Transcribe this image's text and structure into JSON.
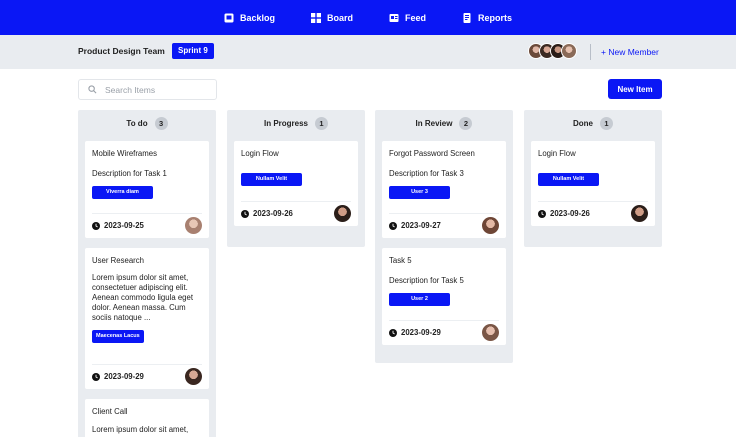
{
  "nav": {
    "items": [
      {
        "label": "Backlog",
        "icon": "backlog-icon"
      },
      {
        "label": "Board",
        "icon": "board-icon"
      },
      {
        "label": "Feed",
        "icon": "feed-icon"
      },
      {
        "label": "Reports",
        "icon": "reports-icon"
      }
    ]
  },
  "team": {
    "name": "Product Design Team",
    "sprint": "Sprint 9",
    "new_member": "+ New Member"
  },
  "toolbar": {
    "search_placeholder": "Search Items",
    "new_item": "New Item"
  },
  "columns": [
    {
      "title": "To do",
      "count": "3",
      "cards": [
        {
          "title": "Mobile Wireframes",
          "description": "Description for Task 1",
          "tag": "Viverra diam",
          "date": "2023-09-25"
        },
        {
          "title": "User Research",
          "description": "Lorem ipsum dolor sit amet, consectetuer adipiscing elit. Aenean commodo ligula eget dolor. Aenean massa. Cum sociis natoque ...",
          "tag": "Maecenas Lacus",
          "date": "2023-09-29"
        },
        {
          "title": "Client Call",
          "description": "Lorem ipsum dolor sit amet,"
        }
      ]
    },
    {
      "title": "In Progress",
      "count": "1",
      "cards": [
        {
          "title": "Login Flow",
          "tag": "Nullam Velit",
          "date": "2023-09-26"
        }
      ]
    },
    {
      "title": "In Review",
      "count": "2",
      "cards": [
        {
          "title": "Forgot Password Screen",
          "description": "Description for Task 3",
          "tag": "User 3",
          "date": "2023-09-27"
        },
        {
          "title": "Task 5",
          "description": "Description for Task 5",
          "tag": "User 2",
          "date": "2023-09-29"
        }
      ]
    },
    {
      "title": "Done",
      "count": "1",
      "cards": [
        {
          "title": "Login Flow",
          "tag": "Nullam Velit",
          "date": "2023-09-26"
        }
      ]
    }
  ],
  "colors": {
    "accent": "#0a17f5",
    "column_bg": "#e9ecf0",
    "page_bg": "#ffffff"
  }
}
